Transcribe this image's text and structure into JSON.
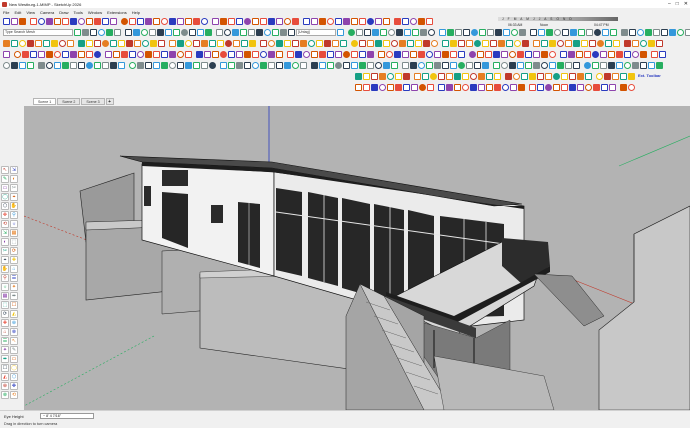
{
  "window": {
    "title": "New Westburg-1-MIMP - SketchUp 2026"
  },
  "menu": [
    "File",
    "Edit",
    "View",
    "Camera",
    "Draw",
    "Tools",
    "Window",
    "Extensions",
    "Help"
  ],
  "toolbar": {
    "style_combo": "Type Search Mesh",
    "layer_combo": "[Untag]"
  },
  "time_widget": {
    "months": "J F M A M J J A S O N D",
    "sunrise": "06:33 AM",
    "noon": "Noon",
    "sunset": "04:47 PM"
  },
  "sketchup_label": "Ext. Toolbar",
  "scenes": {
    "tabs": [
      "Scene 1",
      "Scene 2",
      "Scene 3"
    ],
    "active_index": 0,
    "add_label": "+"
  },
  "status": {
    "measure_label": "Eye Height",
    "measure_value": "~ 8' 4 7/16\"",
    "hint": "Drag in direction to turn camera"
  },
  "colors": {
    "viewport_bg": "#b3b3b3",
    "axis_red": "#c0392b",
    "axis_green": "#27ae60",
    "axis_blue": "#2a3bbf"
  }
}
